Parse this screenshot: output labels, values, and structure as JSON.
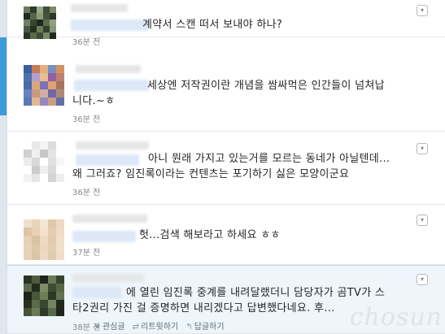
{
  "tweets": [
    {
      "text_lines": [
        "계약서 스캔 떠서 보내야 하나?"
      ],
      "time": "36분 전",
      "avatar_colors": [
        "#6a7d5a",
        "#2f3a2a",
        "#9aa88a",
        "#3f4d35",
        "#7b8a66",
        "#222a1e",
        "#556648",
        "#8d9a7a",
        "#445238",
        "#2c3526",
        "#6f8060",
        "#3a4630",
        "#1f261b",
        "#5d6d4c",
        "#93a07f",
        "#4a5840",
        "#27301f",
        "#6b7b58",
        "#35412c",
        "#86947a",
        "#2b3324",
        "#5a6a48",
        "#3d4a33",
        "#7a8968",
        "#20281c"
      ]
    },
    {
      "text_lines": [
        "세상엔 저작권이란 개념을 쌈싸먹은 인간들이 넘쳐납",
        "니다.~ㅎ"
      ],
      "time": "36분 전",
      "avatar_colors": [
        "#3a5fa0",
        "#c97a5a",
        "#e0b080",
        "#7a8fc0",
        "#d69060",
        "#5070b0",
        "#b0a0d0",
        "#e8c090",
        "#9060a0",
        "#c08070",
        "#4a6aa8",
        "#d8a878",
        "#8070b8",
        "#e0a070",
        "#a07860",
        "#6a80c0",
        "#c89880",
        "#d0b0a0",
        "#7068a8",
        "#b08878",
        "#5a78b8",
        "#e0b890",
        "#9888c0",
        "#c8a080",
        "#6070a8"
      ]
    },
    {
      "text_lines": [
        "아니 뭔래 가지고 있는거를 모르는 동네가 아닐텐데...",
        "왜 그러죠? 임진록이라는 컨텐츠는 포기하기 싫은 모양이군요"
      ],
      "time": "36분 전",
      "avatar_colors": [
        "#ffffff",
        "#e8e8e8",
        "#f4f4f4",
        "#dcdcdc",
        "#ffffff",
        "#d0d0d0",
        "#f0f0f0",
        "#c8c8c8",
        "#e4e4e4",
        "#ffffff",
        "#ececec",
        "#d8d8d8",
        "#ffffff",
        "#e0e0e0",
        "#f6f6f6",
        "#ffffff",
        "#cccccc",
        "#efefef",
        "#dadada",
        "#ffffff",
        "#f2f2f2",
        "#e6e6e6",
        "#ffffff",
        "#d4d4d4",
        "#eeeeee"
      ]
    },
    {
      "text_lines": [
        "헛...검색 해보라고 하세요 ㅎㅎ"
      ],
      "time": "37분 전",
      "avatar_colors": [
        "#f0e0cc",
        "#e8d4bc",
        "#f4e6d4",
        "#e0c8aa",
        "#ecdac4",
        "#dcc4a4",
        "#e8d0b4",
        "#f2e2ce",
        "#e4ccb0",
        "#f0dcc4",
        "#e6d0b6",
        "#dac2a2",
        "#eed8c0",
        "#e2caac",
        "#f0e0ca",
        "#e8d2b8",
        "#dec6a8",
        "#ecd6be",
        "#e4ceb2",
        "#f2e0c8",
        "#e6d2ba",
        "#dcc4a6",
        "#eedac2",
        "#e2ccae",
        "#f0dec6"
      ]
    },
    {
      "text_lines": [
        "에 열린 임진록 중계를 내려달랬더니 담당자가 곰TV가 스",
        "타2권리 가진 걸 증명하면 내리겠다고 답변했다네요. 후..."
      ],
      "time": "38분 전",
      "avatar_colors": [
        "#2a3322",
        "#4d5c3c",
        "#1e2518",
        "#6a7a54",
        "#37432c",
        "#58684a",
        "#232b1c",
        "#7c8c66",
        "#3e4a32",
        "#566646",
        "#1c2216",
        "#4a583a",
        "#6e7e58",
        "#2e3826",
        "#627252",
        "#28301f",
        "#5a6a4a",
        "#3a4630",
        "#748460",
        "#22291b",
        "#465436",
        "#6a7a56",
        "#30392a",
        "#58684a",
        "#1f2619"
      ],
      "actions": [
        {
          "icon": "★",
          "label": "관심글"
        },
        {
          "icon": "⇄",
          "label": "리트윗하기"
        },
        {
          "icon": "↰",
          "label": "답글하기"
        }
      ]
    }
  ],
  "watermark": "chosun"
}
